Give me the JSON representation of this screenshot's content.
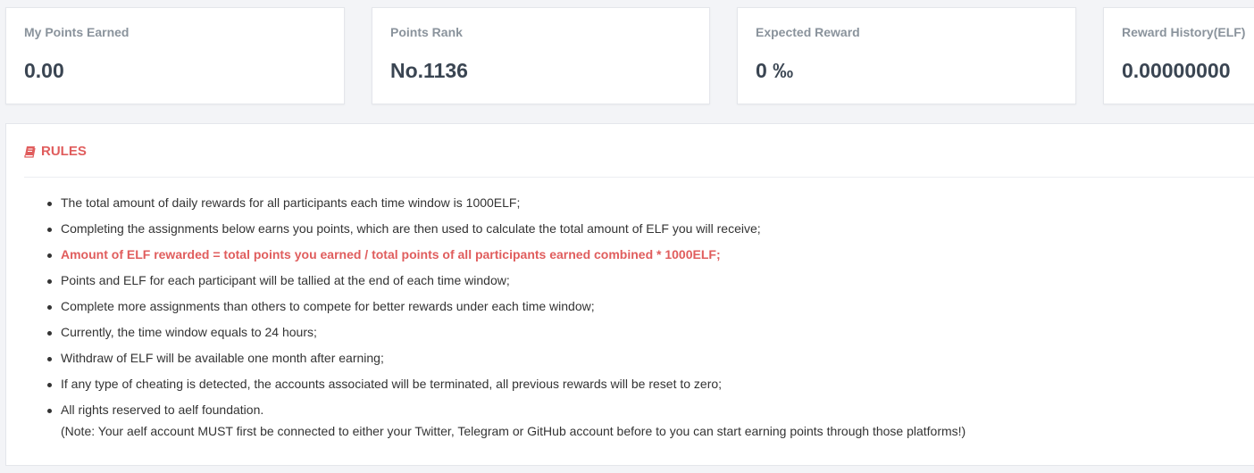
{
  "stats": [
    {
      "label": "My Points Earned",
      "value": "0.00"
    },
    {
      "label": "Points Rank",
      "value": "No.1136"
    },
    {
      "label": "Expected Reward",
      "value": "0 ‰"
    },
    {
      "label": "Reward History(ELF)",
      "value": "0.00000000"
    }
  ],
  "rules": {
    "title": "RULES",
    "icon": "book-icon",
    "accent_color": "#e05d5d",
    "items": [
      "The total amount of daily rewards for all participants each time window is 1000ELF;",
      "Completing the assignments below earns you points, which are then used to calculate the total amount of ELF you will receive;",
      "Amount of ELF rewarded = total points you earned / total points of all participants earned combined * 1000ELF;",
      "Points and ELF for each participant will be tallied at the end of each time window;",
      "Complete more assignments than others to compete for better rewards under each time window;",
      "Currently, the time window equals to 24 hours;",
      "Withdraw of ELF will be available one month after earning;",
      "If any type of cheating is detected, the accounts associated will be terminated, all previous rewards will be reset to zero;",
      "All rights reserved to aelf foundation."
    ],
    "note": "(Note: Your aelf account MUST first be connected to either your Twitter, Telegram or GitHub account before to you can start earning points through those platforms!)"
  }
}
